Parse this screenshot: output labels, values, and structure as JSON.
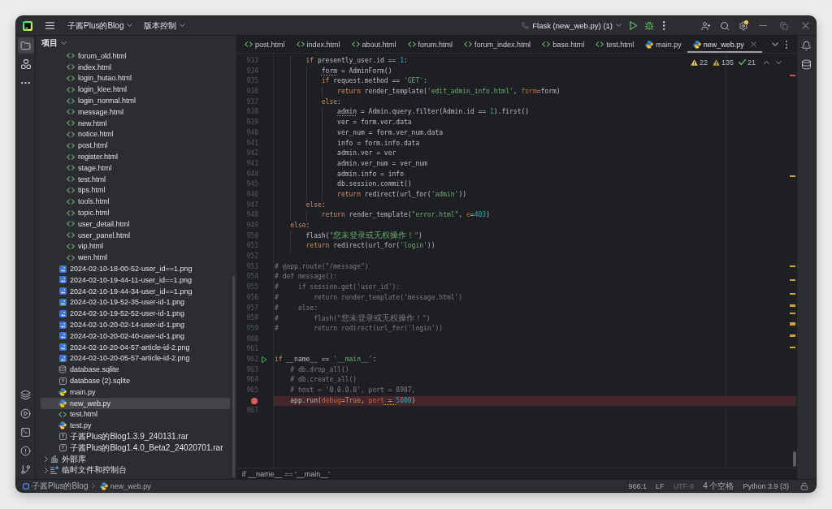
{
  "title_bar": {
    "project_menu": "子酱Plus的Blog",
    "vcs_menu": "版本控制",
    "run_configuration": "Flask (new_web.py) (1)",
    "settings_badge": true
  },
  "left_toolbar": {
    "top": [
      {
        "kind": "project",
        "selected": true
      },
      {
        "kind": "structure",
        "selected": false
      },
      {
        "kind": "more",
        "selected": false
      }
    ],
    "bottom": [
      {
        "kind": "packages",
        "selected": false
      },
      {
        "kind": "run",
        "selected": false
      },
      {
        "kind": "terminal",
        "selected": false
      },
      {
        "kind": "problems",
        "selected": false
      },
      {
        "kind": "git",
        "selected": false
      }
    ]
  },
  "project_panel": {
    "title": "项目",
    "tree": [
      {
        "children": [
          {
            "children": [
              {
                "kind": "html",
                "label": "forum_old.html",
                "selected": false
              },
              {
                "kind": "html",
                "label": "index.html",
                "selected": false
              },
              {
                "kind": "html",
                "label": "login_hutao.html",
                "selected": false
              },
              {
                "kind": "html",
                "label": "login_klee.html",
                "selected": false
              },
              {
                "kind": "html",
                "label": "login_normal.html",
                "selected": false
              },
              {
                "kind": "html",
                "label": "message.html",
                "selected": false
              },
              {
                "kind": "html",
                "label": "new.html",
                "selected": false
              },
              {
                "kind": "html",
                "label": "notice.html",
                "selected": false
              },
              {
                "kind": "html",
                "label": "post.html",
                "selected": false
              },
              {
                "kind": "html",
                "label": "register.html",
                "selected": false
              },
              {
                "kind": "html",
                "label": "stage.html",
                "selected": false
              },
              {
                "kind": "html",
                "label": "test.html",
                "selected": false
              },
              {
                "kind": "html",
                "label": "tips.html",
                "selected": false
              },
              {
                "kind": "html",
                "label": "tools.html",
                "selected": false
              },
              {
                "kind": "html",
                "label": "topic.html",
                "selected": false
              },
              {
                "kind": "html",
                "label": "user_detail.html",
                "selected": false
              },
              {
                "kind": "html",
                "label": "user_panel.html",
                "selected": false
              },
              {
                "kind": "html",
                "label": "vip.html",
                "selected": false
              },
              {
                "kind": "html",
                "label": "wen.html",
                "selected": false
              }
            ]
          },
          {
            "kind": "image",
            "label": "2024-02-10-18-00-52-user_id==1.png",
            "selected": false
          },
          {
            "kind": "image",
            "label": "2024-02-10-19-44-11-user_id==1.png",
            "selected": false
          },
          {
            "kind": "image",
            "label": "2024-02-10-19-44-34-user_id==1.png",
            "selected": false
          },
          {
            "kind": "image",
            "label": "2024-02-10-19-52-35-user-id-1.png",
            "selected": false
          },
          {
            "kind": "image",
            "label": "2024-02-10-19-52-52-user-id-1.png",
            "selected": false
          },
          {
            "kind": "image",
            "label": "2024-02-10-20-02-14-user-id-1.png",
            "selected": false
          },
          {
            "kind": "image",
            "label": "2024-02-10-20-02-40-user-id-1.png",
            "selected": false
          },
          {
            "kind": "image",
            "label": "2024-02-10-20-04-57-article-id-2.png",
            "selected": false
          },
          {
            "kind": "image",
            "label": "2024-02-10-20-05-57-article-id-2.png",
            "selected": false
          },
          {
            "kind": "database",
            "label": "database.sqlite",
            "selected": false
          },
          {
            "kind": "unknown",
            "label": "database (2).sqlite",
            "selected": false
          },
          {
            "kind": "python",
            "label": "main.py",
            "selected": false
          },
          {
            "kind": "python",
            "label": "new_web.py",
            "selected": true
          },
          {
            "kind": "html",
            "label": "test.html",
            "selected": false
          },
          {
            "kind": "python",
            "label": "test.py",
            "selected": false
          },
          {
            "kind": "unknown",
            "label": "子酱Plus的Blog1.3.9_240131.rar",
            "selected": false
          },
          {
            "kind": "unknown",
            "label": "子酱Plus的Blog1.4.0_Beta2_24020701.rar",
            "selected": false
          }
        ]
      },
      {
        "kind": "library",
        "label": "外部库",
        "expanded": false,
        "selected": false
      },
      {
        "kind": "scratches",
        "label": "临时文件和控制台",
        "expanded": false,
        "selected": false
      }
    ]
  },
  "editor": {
    "tabs": [
      {
        "kind": "html",
        "label": "post.html",
        "selected": false
      },
      {
        "kind": "html",
        "label": "index.html",
        "selected": false
      },
      {
        "kind": "html",
        "label": "about.html",
        "selected": false
      },
      {
        "kind": "html",
        "label": "forum.html",
        "selected": false
      },
      {
        "kind": "html",
        "label": "forum_index.html",
        "selected": false
      },
      {
        "kind": "html",
        "label": "base.html",
        "selected": false
      },
      {
        "kind": "html",
        "label": "test.html",
        "selected": false
      },
      {
        "kind": "python",
        "label": "main.py",
        "selected": false
      },
      {
        "kind": "python",
        "label": "new_web.py",
        "selected": true
      }
    ],
    "inspections": [
      {
        "kind": "warning",
        "count": "22"
      },
      {
        "kind": "weak_warning",
        "count": "135"
      },
      {
        "kind": "typo",
        "count": "21"
      }
    ],
    "lines": [
      {
        "number": "933",
        "breakpoint": false,
        "run_gutter": false,
        "tokens": [
          {
            "kind": "keyword",
            "text": "        if"
          },
          {
            "kind": "plain",
            "text": " presently_user.id == "
          },
          {
            "kind": "number",
            "text": "1"
          },
          {
            "kind": "plain",
            "text": ":"
          }
        ]
      },
      {
        "number": "934",
        "breakpoint": false,
        "run_gutter": false,
        "tokens": [
          {
            "kind": "warn",
            "text": "            form"
          },
          {
            "kind": "plain",
            "text": " = AdminForm()"
          }
        ]
      },
      {
        "number": "935",
        "breakpoint": false,
        "run_gutter": false,
        "tokens": [
          {
            "kind": "keyword",
            "text": "            if"
          },
          {
            "kind": "plain",
            "text": " request.method == "
          },
          {
            "kind": "string",
            "text": "'GET'"
          },
          {
            "kind": "plain",
            "text": ":"
          }
        ]
      },
      {
        "number": "936",
        "breakpoint": false,
        "run_gutter": false,
        "tokens": [
          {
            "kind": "keyword",
            "text": "                return"
          },
          {
            "kind": "plain",
            "text": " render_template("
          },
          {
            "kind": "string",
            "text": "'edit_admin_info.html'"
          },
          {
            "kind": "plain",
            "text": ", "
          },
          {
            "kind": "param",
            "text": "form"
          },
          {
            "kind": "plain",
            "text": "=form)"
          }
        ]
      },
      {
        "number": "937",
        "breakpoint": false,
        "run_gutter": false,
        "tokens": [
          {
            "kind": "keyword",
            "text": "            else"
          },
          {
            "kind": "plain",
            "text": ":"
          }
        ]
      },
      {
        "number": "938",
        "breakpoint": false,
        "run_gutter": false,
        "tokens": [
          {
            "kind": "warn",
            "text": "                admin"
          },
          {
            "kind": "plain",
            "text": " = Admin.query.filter(Admin.id == "
          },
          {
            "kind": "number",
            "text": "1"
          },
          {
            "kind": "plain",
            "text": ").first()"
          }
        ]
      },
      {
        "number": "939",
        "breakpoint": false,
        "run_gutter": false,
        "tokens": [
          {
            "kind": "plain",
            "text": "                ver = form.ver.data"
          }
        ]
      },
      {
        "number": "940",
        "breakpoint": false,
        "run_gutter": false,
        "tokens": [
          {
            "kind": "plain",
            "text": "                ver_num = form.ver_num.data"
          }
        ]
      },
      {
        "number": "941",
        "breakpoint": false,
        "run_gutter": false,
        "tokens": [
          {
            "kind": "plain",
            "text": "                info = form.info.data"
          }
        ]
      },
      {
        "number": "942",
        "breakpoint": false,
        "run_gutter": false,
        "tokens": [
          {
            "kind": "plain",
            "text": "                admin.ver = ver"
          }
        ]
      },
      {
        "number": "943",
        "breakpoint": false,
        "run_gutter": false,
        "tokens": [
          {
            "kind": "plain",
            "text": "                admin.ver_num = ver_num"
          }
        ]
      },
      {
        "number": "944",
        "breakpoint": false,
        "run_gutter": false,
        "tokens": [
          {
            "kind": "plain",
            "text": "                admin.info = info"
          }
        ]
      },
      {
        "number": "945",
        "breakpoint": false,
        "run_gutter": false,
        "tokens": [
          {
            "kind": "plain",
            "text": "                db.session.commit()"
          }
        ]
      },
      {
        "number": "946",
        "breakpoint": false,
        "run_gutter": false,
        "tokens": [
          {
            "kind": "keyword",
            "text": "                return"
          },
          {
            "kind": "plain",
            "text": " redirect(url_for("
          },
          {
            "kind": "string",
            "text": "'admin'"
          },
          {
            "kind": "plain",
            "text": "))"
          }
        ]
      },
      {
        "number": "947",
        "breakpoint": false,
        "run_gutter": false,
        "tokens": [
          {
            "kind": "keyword",
            "text": "        else"
          },
          {
            "kind": "plain",
            "text": ":"
          }
        ]
      },
      {
        "number": "948",
        "breakpoint": false,
        "run_gutter": false,
        "tokens": [
          {
            "kind": "keyword",
            "text": "            return"
          },
          {
            "kind": "plain",
            "text": " render_template("
          },
          {
            "kind": "string",
            "text": "\"error.html\""
          },
          {
            "kind": "plain",
            "text": ", "
          },
          {
            "kind": "param",
            "text": "e"
          },
          {
            "kind": "plain",
            "text": "="
          },
          {
            "kind": "number",
            "text": "403"
          },
          {
            "kind": "plain",
            "text": ")"
          }
        ]
      },
      {
        "number": "949",
        "breakpoint": false,
        "run_gutter": false,
        "tokens": [
          {
            "kind": "keyword",
            "text": "    else"
          },
          {
            "kind": "plain",
            "text": ":"
          }
        ]
      },
      {
        "number": "950",
        "breakpoint": false,
        "run_gutter": false,
        "tokens": [
          {
            "kind": "plain",
            "text": "        flash("
          },
          {
            "kind": "string",
            "text": "\"您未登录或无权操作！\""
          },
          {
            "kind": "plain",
            "text": ")"
          }
        ]
      },
      {
        "number": "951",
        "breakpoint": false,
        "run_gutter": false,
        "tokens": [
          {
            "kind": "keyword",
            "text": "        return"
          },
          {
            "kind": "plain",
            "text": " redirect(url_for("
          },
          {
            "kind": "string",
            "text": "'login'"
          },
          {
            "kind": "plain",
            "text": "))"
          }
        ]
      },
      {
        "number": "952",
        "breakpoint": false,
        "run_gutter": false
      },
      {
        "number": "953",
        "breakpoint": false,
        "run_gutter": false,
        "tokens": [
          {
            "kind": "comment",
            "text": "# @app.route(\"/message\")"
          }
        ]
      },
      {
        "number": "954",
        "breakpoint": false,
        "run_gutter": false,
        "tokens": [
          {
            "kind": "comment",
            "text": "# def message():"
          }
        ]
      },
      {
        "number": "955",
        "breakpoint": false,
        "run_gutter": false,
        "tokens": [
          {
            "kind": "comment",
            "text": "#     if session.get('user_id'):"
          }
        ]
      },
      {
        "number": "956",
        "breakpoint": false,
        "run_gutter": false,
        "tokens": [
          {
            "kind": "comment",
            "text": "#         return render_template('message.html')"
          }
        ]
      },
      {
        "number": "957",
        "breakpoint": false,
        "run_gutter": false,
        "tokens": [
          {
            "kind": "comment",
            "text": "#     else:"
          }
        ]
      },
      {
        "number": "958",
        "breakpoint": false,
        "run_gutter": false,
        "tokens": [
          {
            "kind": "comment",
            "text": "#         flash(\"您未登录或无权操作！\")"
          }
        ]
      },
      {
        "number": "959",
        "breakpoint": false,
        "run_gutter": false,
        "tokens": [
          {
            "kind": "comment",
            "text": "#         return redirect(url_for('login'))"
          }
        ]
      },
      {
        "number": "960",
        "breakpoint": false,
        "run_gutter": false
      },
      {
        "number": "961",
        "breakpoint": false,
        "run_gutter": false
      },
      {
        "number": "962",
        "breakpoint": false,
        "run_gutter": true,
        "tokens": [
          {
            "kind": "keyword",
            "text": "if"
          },
          {
            "kind": "plain",
            "text": " __name__ == "
          },
          {
            "kind": "string",
            "text": "'__main__'"
          },
          {
            "kind": "plain",
            "text": ":"
          }
        ]
      },
      {
        "number": "963",
        "breakpoint": false,
        "run_gutter": false,
        "tokens": [
          {
            "kind": "comment",
            "text": "    # db.drop_all()"
          }
        ]
      },
      {
        "number": "964",
        "breakpoint": false,
        "run_gutter": false,
        "tokens": [
          {
            "kind": "comment",
            "text": "    # db.create_all()"
          }
        ]
      },
      {
        "number": "965",
        "breakpoint": false,
        "run_gutter": false,
        "tokens": [
          {
            "kind": "comment",
            "text": "    # host = '0.0.0.0', port = 8987,"
          }
        ]
      },
      {
        "breakpoint": true,
        "run_gutter": false,
        "tokens": [
          {
            "kind": "plain",
            "text": "    app.run("
          },
          {
            "kind": "param",
            "text": "debug"
          },
          {
            "kind": "plain",
            "text": "="
          },
          {
            "kind": "keyword",
            "text": "True"
          },
          {
            "kind": "plain",
            "text": ", "
          },
          {
            "kind": "param",
            "text": "port"
          },
          {
            "kind": "warn",
            "text": " = "
          },
          {
            "kind": "number",
            "text": "5000"
          },
          {
            "kind": "plain",
            "text": ")"
          }
        ]
      },
      {
        "number": "967",
        "breakpoint": false,
        "run_gutter": false
      }
    ],
    "breadcrumb": "if __name__ == '__main__'"
  },
  "right_toolbar": [
    {
      "kind": "notifications",
      "selected": false
    },
    {
      "kind": "database",
      "selected": false
    }
  ],
  "status_bar": {
    "path": [
      {
        "kind": "project",
        "label": "子酱Plus的Blog"
      },
      {
        "kind": "python",
        "label": "new_web.py"
      }
    ],
    "items": [
      {
        "text": "966:1",
        "disabled": false
      },
      {
        "text": "LF",
        "disabled": false
      },
      {
        "text": "UTF-8",
        "disabled": true
      },
      {
        "text": "4 个空格",
        "disabled": false
      },
      {
        "text": "Python 3.9 (3)",
        "disabled": false
      }
    ]
  }
}
